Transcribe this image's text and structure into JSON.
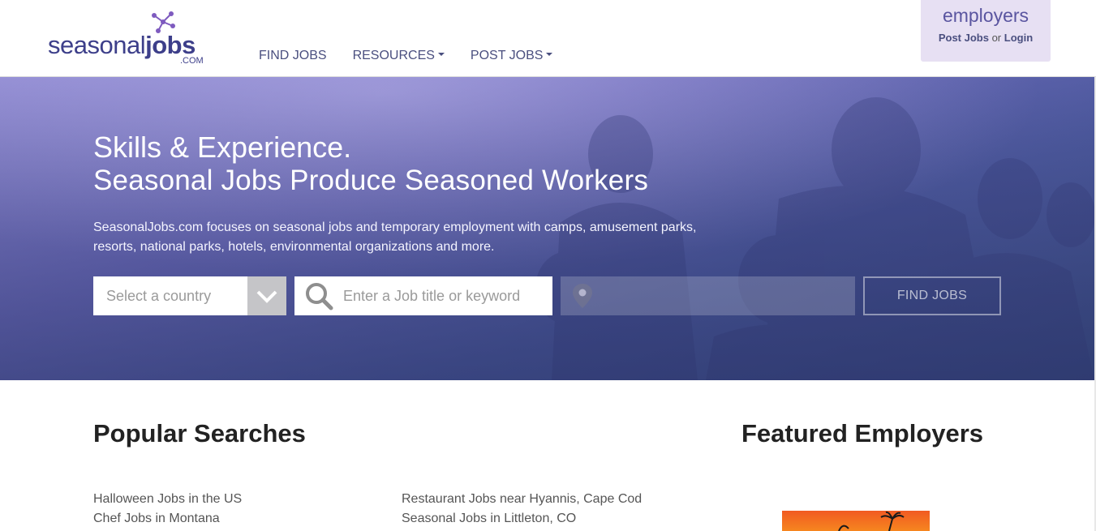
{
  "header": {
    "logo": {
      "text_light": "seasonal",
      "text_bold": "jobs",
      "suffix": ".COM"
    },
    "nav": [
      {
        "label": "FIND JOBS",
        "has_caret": false
      },
      {
        "label": "RESOURCES",
        "has_caret": true
      },
      {
        "label": "POST JOBS",
        "has_caret": true
      }
    ],
    "employers": {
      "title": "employers",
      "post_jobs": "Post Jobs",
      "or": "or",
      "login": "Login"
    }
  },
  "hero": {
    "title_line1": "Skills & Experience.",
    "title_line2": "Seasonal Jobs Produce Seasoned Workers",
    "description": "SeasonalJobs.com focuses on seasonal jobs and temporary employment with camps, amusement parks, resorts, national parks, hotels, environmental organizations and more.",
    "search": {
      "country_placeholder": "Select a country",
      "keyword_placeholder": "Enter a Job title or keyword",
      "location_placeholder": "",
      "button_label": "FIND JOBS"
    }
  },
  "popular": {
    "title": "Popular Searches",
    "col1": [
      "Halloween Jobs in the US",
      "Chef Jobs in Montana"
    ],
    "col2": [
      "Restaurant Jobs near Hyannis, Cape Cod",
      "Seasonal Jobs in Littleton, CO"
    ]
  },
  "featured": {
    "title": "Featured Employers"
  },
  "colors": {
    "brand": "#3d3f8a",
    "nav_text": "#4a4f7f",
    "employers_bg": "#e7e0f3",
    "hero_overlay": "#6a69b8"
  },
  "icons": [
    "logo-mark-icon",
    "caret-down-icon",
    "chevron-down-icon",
    "search-icon",
    "map-pin-icon"
  ]
}
